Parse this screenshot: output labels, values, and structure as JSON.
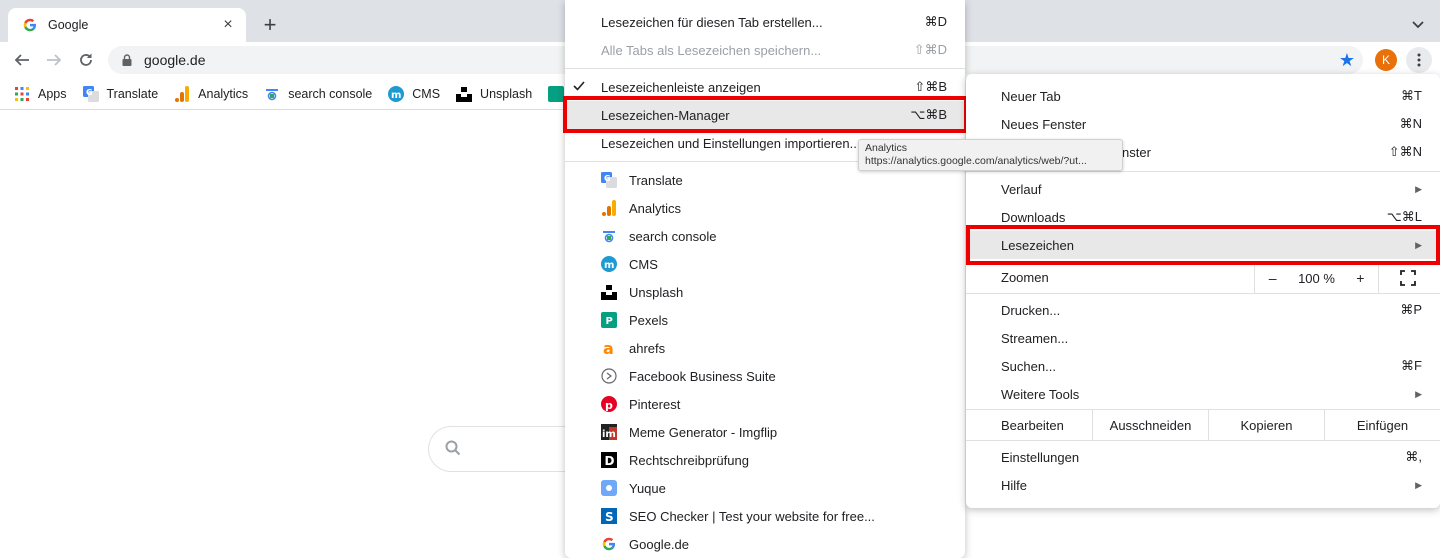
{
  "browser": {
    "tab": {
      "title": "Google",
      "favicon": "google-g-icon"
    },
    "url": "google.de",
    "profile_initial": "K"
  },
  "bookmarks_bar": [
    {
      "label": "Apps",
      "icon": "apps-grid-icon"
    },
    {
      "label": "Translate",
      "icon": "translate-icon"
    },
    {
      "label": "Analytics",
      "icon": "analytics-icon"
    },
    {
      "label": "search console",
      "icon": "search-console-icon"
    },
    {
      "label": "CMS",
      "icon": "cms-icon"
    },
    {
      "label": "Unsplash",
      "icon": "unsplash-icon"
    }
  ],
  "bookmark_menu": {
    "actions": [
      {
        "label": "Lesezeichen für diesen Tab erstellen...",
        "shortcut": "⌘D",
        "enabled": true
      },
      {
        "label": "Alle Tabs als Lesezeichen speichern...",
        "shortcut": "⇧⌘D",
        "enabled": false
      },
      {
        "label": "Lesezeichenleiste anzeigen",
        "shortcut": "⇧⌘B",
        "checked": true
      },
      {
        "label": "Lesezeichen-Manager",
        "shortcut": "⌥⌘B",
        "highlighted": true
      },
      {
        "label": "Lesezeichen und Einstellungen importieren..."
      }
    ],
    "bookmarks": [
      {
        "label": "Translate",
        "icon": "translate-icon"
      },
      {
        "label": "Analytics",
        "icon": "analytics-icon"
      },
      {
        "label": "search console",
        "icon": "search-console-icon"
      },
      {
        "label": "CMS",
        "icon": "cms-icon"
      },
      {
        "label": "Unsplash",
        "icon": "unsplash-icon"
      },
      {
        "label": "Pexels",
        "icon": "pexels-icon"
      },
      {
        "label": "ahrefs",
        "icon": "ahrefs-icon"
      },
      {
        "label": "Facebook Business Suite",
        "icon": "facebook-business-icon"
      },
      {
        "label": "Pinterest",
        "icon": "pinterest-icon"
      },
      {
        "label": "Meme Generator - Imgflip",
        "icon": "imgflip-icon"
      },
      {
        "label": "Rechtschreibprüfung",
        "icon": "duden-icon"
      },
      {
        "label": "Yuque",
        "icon": "yuque-icon"
      },
      {
        "label": "SEO Checker | Test your website for free...",
        "icon": "seo-checker-icon"
      },
      {
        "label": "Google.de",
        "icon": "google-g-icon"
      }
    ]
  },
  "tooltip": {
    "title": "Analytics",
    "url": "https://analytics.google.com/analytics/web/?ut..."
  },
  "main_menu": {
    "group1": [
      {
        "label": "Neuer Tab",
        "shortcut": "⌘T"
      },
      {
        "label": "Neues Fenster",
        "shortcut": "⌘N"
      },
      {
        "label": "Neues Inkognitofenster",
        "visible_label": "nster",
        "shortcut": "⇧⌘N"
      }
    ],
    "group2": [
      {
        "label": "Verlauf",
        "submenu": true
      },
      {
        "label": "Downloads",
        "shortcut": "⌥⌘L"
      },
      {
        "label": "Lesezeichen",
        "submenu": true,
        "highlighted": true
      }
    ],
    "zoom": {
      "label": "Zoomen",
      "minus": "–",
      "value": "100 %",
      "plus": "+"
    },
    "group3": [
      {
        "label": "Drucken...",
        "shortcut": "⌘P"
      },
      {
        "label": "Streamen..."
      },
      {
        "label": "Suchen...",
        "shortcut": "⌘F"
      },
      {
        "label": "Weitere Tools",
        "submenu": true
      }
    ],
    "edit": {
      "label": "Bearbeiten",
      "cut": "Ausschneiden",
      "copy": "Kopieren",
      "paste": "Einfügen"
    },
    "group4": [
      {
        "label": "Einstellungen",
        "shortcut": "⌘,"
      },
      {
        "label": "Hilfe",
        "submenu": true
      }
    ]
  },
  "colors": {
    "highlight_border": "#ee0000",
    "star": "#1a73e8",
    "avatar": "#e8710a"
  }
}
